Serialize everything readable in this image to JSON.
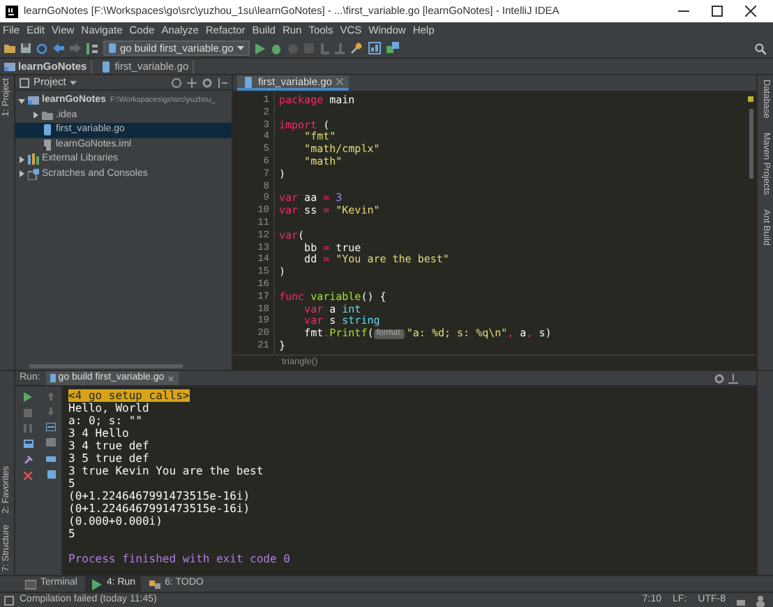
{
  "window": {
    "title": "learnGoNotes [F:\\Workspaces\\go\\src\\yuzhou_1su\\learnGoNotes] - ...\\first_variable.go [learnGoNotes] - IntelliJ IDEA"
  },
  "menu": [
    "File",
    "Edit",
    "View",
    "Navigate",
    "Code",
    "Analyze",
    "Refactor",
    "Build",
    "Run",
    "Tools",
    "VCS",
    "Window",
    "Help"
  ],
  "toolbar": {
    "run_config": "go build first_variable.go"
  },
  "breadcrumbs": [
    {
      "label": "learnGoNotes",
      "kind": "module"
    },
    {
      "label": "first_variable.go",
      "kind": "gofile"
    }
  ],
  "left_strip": {
    "top": [
      "1: Project"
    ],
    "bottom": [
      "2: Favorites",
      "7: Structure"
    ]
  },
  "project_panel": {
    "title": "Project",
    "tree": [
      {
        "label": "learnGoNotes",
        "path": "F:\\Workspaces\\go\\src\\yuzhou_",
        "kind": "module",
        "expanded": true,
        "selected": false,
        "children": [
          {
            "label": ".idea",
            "kind": "folder",
            "expanded": false,
            "selected": false
          },
          {
            "label": "first_variable.go",
            "kind": "gofile",
            "selected": true
          },
          {
            "label": "learnGoNotes.iml",
            "kind": "iml",
            "selected": false
          }
        ]
      },
      {
        "label": "External Libraries",
        "kind": "libraries",
        "expanded": false,
        "selected": false
      },
      {
        "label": "Scratches and Consoles",
        "kind": "scratches",
        "expanded": false,
        "selected": false
      }
    ]
  },
  "editor": {
    "tabs": [
      {
        "label": "first_variable.go",
        "selected": true
      }
    ],
    "lines": [
      {
        "n": "1",
        "tokens": [
          {
            "kind": "keyword",
            "text": "package"
          },
          {
            "kind": "plain",
            "text": " main"
          }
        ]
      },
      {
        "n": "2"
      },
      {
        "n": "3",
        "tokens": [
          {
            "kind": "keyword",
            "text": "import"
          },
          {
            "kind": "plain",
            "text": " ("
          }
        ]
      },
      {
        "n": "4",
        "tokens": [
          {
            "kind": "string",
            "text": "    \"fmt\""
          }
        ]
      },
      {
        "n": "5",
        "tokens": [
          {
            "kind": "string",
            "text": "    \"math/cmplx\""
          }
        ]
      },
      {
        "n": "6",
        "tokens": [
          {
            "kind": "string",
            "text": "    \"math\""
          }
        ]
      },
      {
        "n": "7",
        "tokens": [
          {
            "kind": "plain",
            "text": ")"
          }
        ]
      },
      {
        "n": "8"
      },
      {
        "n": "9",
        "tokens": [
          {
            "kind": "keyword",
            "text": "var"
          },
          {
            "kind": "plain",
            "text": " aa "
          },
          {
            "kind": "keyword",
            "text": "="
          },
          {
            "kind": "number",
            "text": " 3"
          }
        ]
      },
      {
        "n": "10",
        "tokens": [
          {
            "kind": "keyword",
            "text": "var"
          },
          {
            "kind": "plain",
            "text": " ss "
          },
          {
            "kind": "keyword",
            "text": "="
          },
          {
            "kind": "string",
            "text": " \"Kevin\""
          }
        ]
      },
      {
        "n": "11"
      },
      {
        "n": "12",
        "tokens": [
          {
            "kind": "keyword",
            "text": "var"
          },
          {
            "kind": "plain",
            "text": "("
          }
        ]
      },
      {
        "n": "13",
        "tokens": [
          {
            "kind": "plain",
            "text": "    bb "
          },
          {
            "kind": "keyword",
            "text": "="
          },
          {
            "kind": "plain",
            "text": " true"
          }
        ]
      },
      {
        "n": "14",
        "tokens": [
          {
            "kind": "plain",
            "text": "    dd "
          },
          {
            "kind": "keyword",
            "text": "="
          },
          {
            "kind": "string",
            "text": " \"You are the best\""
          }
        ]
      },
      {
        "n": "15",
        "tokens": [
          {
            "kind": "plain",
            "text": ")"
          }
        ]
      },
      {
        "n": "16"
      },
      {
        "n": "17",
        "tokens": [
          {
            "kind": "keyword",
            "text": "func"
          },
          {
            "kind": "function",
            "text": " variable"
          },
          {
            "kind": "plain",
            "text": "() {"
          }
        ]
      },
      {
        "n": "18",
        "tokens": [
          {
            "kind": "keyword",
            "text": "    var"
          },
          {
            "kind": "plain",
            "text": " a "
          },
          {
            "kind": "type",
            "text": "int"
          }
        ]
      },
      {
        "n": "19",
        "tokens": [
          {
            "kind": "keyword",
            "text": "    var"
          },
          {
            "kind": "plain",
            "text": " s "
          },
          {
            "kind": "type",
            "text": "string"
          }
        ]
      },
      {
        "n": "20",
        "tokens": [
          {
            "kind": "plain",
            "text": "    fmt"
          },
          {
            "kind": "keyword",
            "text": "."
          },
          {
            "kind": "function",
            "text": "Printf"
          },
          {
            "kind": "plain",
            "text": "("
          },
          {
            "kind": "hint",
            "text": "format:"
          },
          {
            "kind": "string",
            "text": "\"a: %d; s: %q\\n\""
          },
          {
            "kind": "keyword",
            "text": ","
          },
          {
            "kind": "plain",
            "text": " a"
          },
          {
            "kind": "keyword",
            "text": ","
          },
          {
            "kind": "plain",
            "text": " s)"
          }
        ]
      },
      {
        "n": "21",
        "tokens": [
          {
            "kind": "plain",
            "text": "}"
          }
        ]
      }
    ],
    "footer": "triangle()"
  },
  "right_strip": [
    "Database",
    "Maven Projects",
    "Ant Build"
  ],
  "run_panel": {
    "label": "Run:",
    "tab": "go build first_variable.go",
    "output": [
      {
        "kind": "setup",
        "text": "<4 go setup calls>"
      },
      {
        "kind": "normal",
        "text": "Hello, World"
      },
      {
        "kind": "normal",
        "text": "a: 0; s: \"\""
      },
      {
        "kind": "normal",
        "text": "3 4 Hello"
      },
      {
        "kind": "normal",
        "text": "3 4 true def"
      },
      {
        "kind": "normal",
        "text": "3 5 true def"
      },
      {
        "kind": "normal",
        "text": "3 true Kevin You are the best"
      },
      {
        "kind": "normal",
        "text": "5"
      },
      {
        "kind": "normal",
        "text": "(0+1.2246467991473515e-16i)"
      },
      {
        "kind": "normal",
        "text": "(0+1.2246467991473515e-16i)"
      },
      {
        "kind": "normal",
        "text": "(0.000+0.000i)"
      },
      {
        "kind": "normal",
        "text": "5"
      },
      {
        "kind": "blank"
      },
      {
        "kind": "exit",
        "text": "Process finished with exit code 0"
      }
    ]
  },
  "tool_tabs": [
    {
      "label": "Terminal",
      "kind": "terminal",
      "selected": false
    },
    {
      "label": "4: Run",
      "kind": "run",
      "selected": true
    },
    {
      "label": "6: TODO",
      "kind": "todo",
      "selected": false
    }
  ],
  "status_bar": {
    "message": "Compilation failed (today 11:45)",
    "position": "7:10",
    "line_sep": "LF:",
    "encoding": "UTF-8"
  }
}
